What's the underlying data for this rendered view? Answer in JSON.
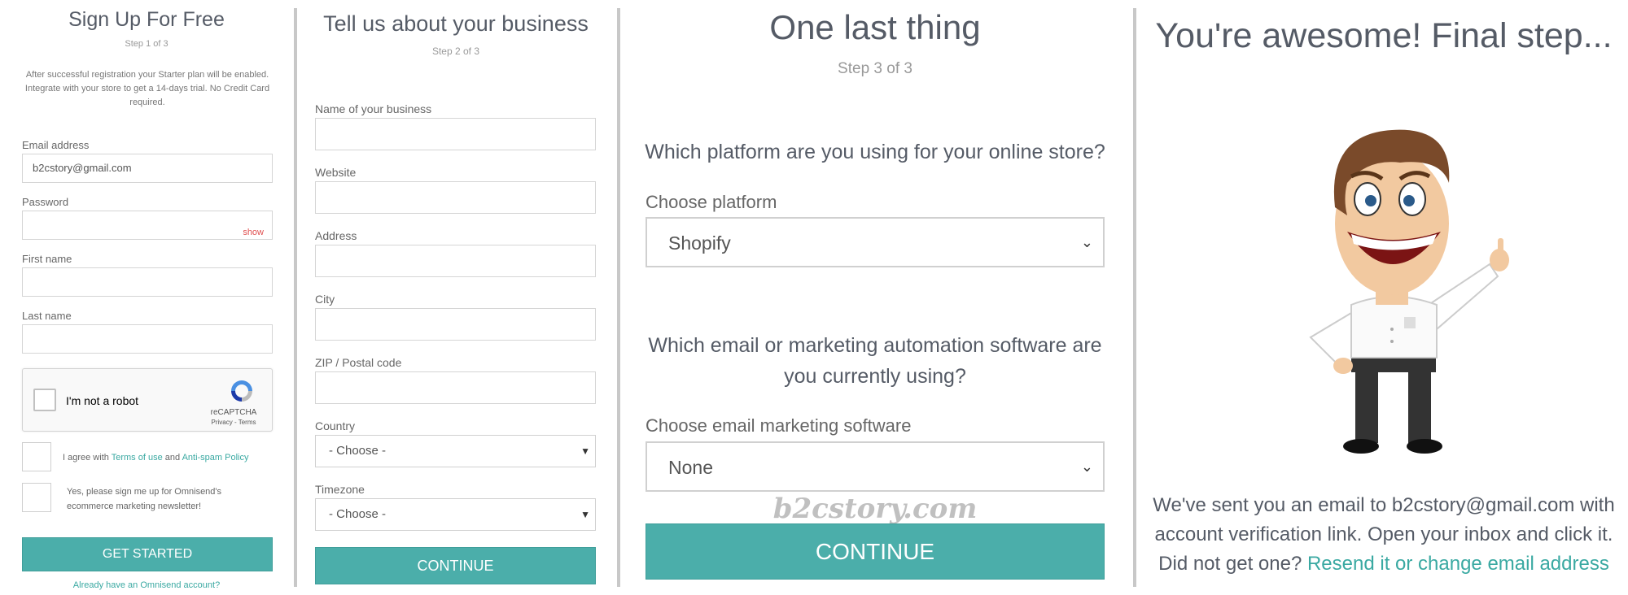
{
  "signup": {
    "title": "Sign Up For Free",
    "step": "Step 1 of 3",
    "note": "After successful registration your Starter plan will be enabled. Integrate with your store to get a 14-days trial. No Credit Card required.",
    "email_label": "Email address",
    "email_value": "b2cstory@gmail.com",
    "password_label": "Password",
    "password_show": "show",
    "first_name_label": "First name",
    "last_name_label": "Last name",
    "recaptcha": {
      "text": "I'm not a robot",
      "brand": "reCAPTCHA",
      "terms": "Privacy - Terms"
    },
    "agree_prefix": "I agree with ",
    "terms_link": "Terms of use",
    "agree_and": " and ",
    "antispam_link": "Anti-spam Policy",
    "newsletter_label": "Yes, please sign me up for Omnisend's ecommerce marketing newsletter!",
    "button": "GET STARTED",
    "already": "Already have an Omnisend account?"
  },
  "business": {
    "title": "Tell us about your business",
    "step": "Step 2 of 3",
    "name_label": "Name of your business",
    "website_label": "Website",
    "address_label": "Address",
    "city_label": "City",
    "zip_label": "ZIP / Postal code",
    "country_label": "Country",
    "country_value": "- Choose -",
    "timezone_label": "Timezone",
    "timezone_value": "- Choose -",
    "button": "CONTINUE"
  },
  "last": {
    "title": "One last thing",
    "step": "Step 3 of 3",
    "q1": "Which platform are you using for your online store?",
    "platform_label": "Choose platform",
    "platform_value": "Shopify",
    "q2_line1": "Which email or marketing automation software are",
    "q2_line2": "you currently using?",
    "software_label": "Choose email marketing software",
    "software_value": "None",
    "button": "CONTINUE",
    "watermark": "b2cstory.com"
  },
  "final": {
    "title": "You're awesome! Final step...",
    "msg_line1": "We've sent you an email to b2cstory@gmail.com with",
    "msg_line2": "account verification link. Open your inbox and click it.",
    "msg_line3": "Did not get one? ",
    "resend_link": "Resend it or change email address"
  },
  "colors": {
    "accent": "#4baeaa",
    "link": "#3aa9a2",
    "divider": "#c8c8c8"
  }
}
